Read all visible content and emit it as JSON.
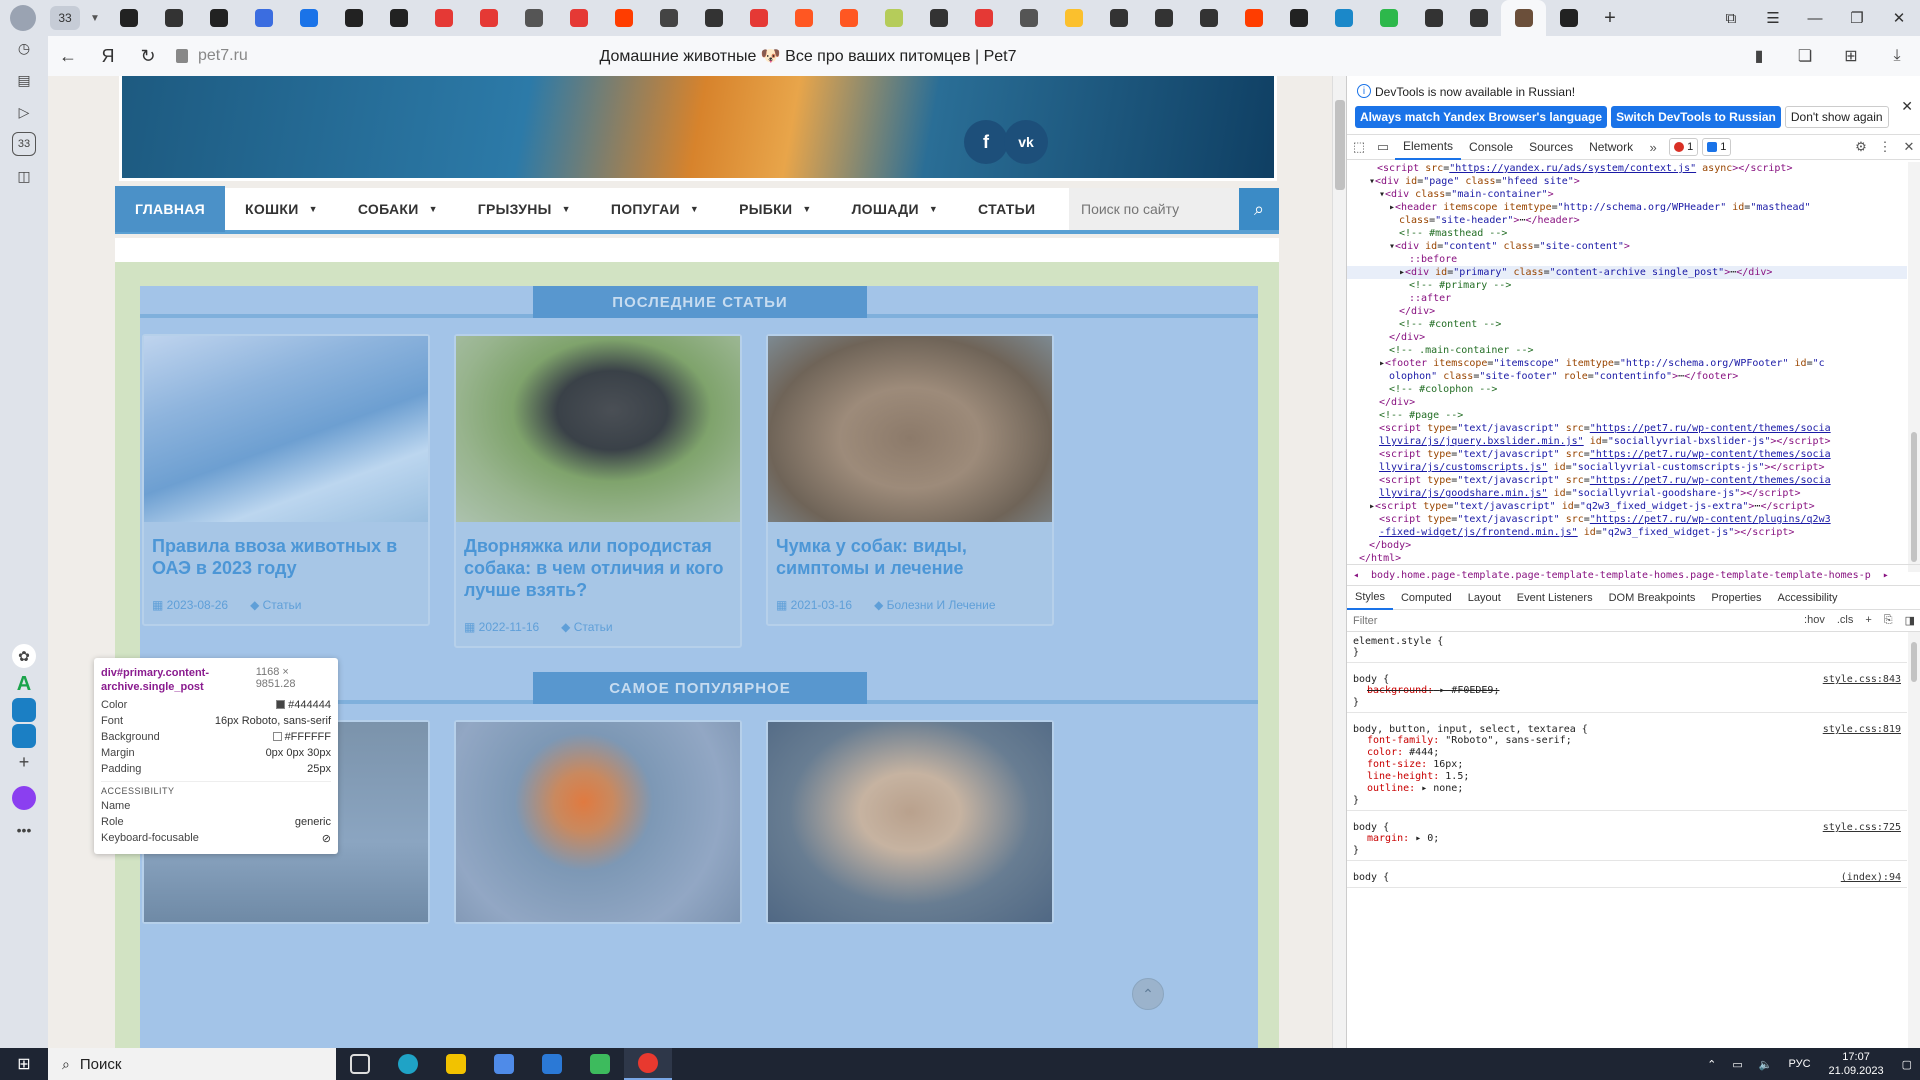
{
  "browser": {
    "tab_counter": "33",
    "url": "pet7.ru",
    "page_title": "Домашние животные 🐶 Все про ваших питомцев | Pet7",
    "tab_favicon_colors": [
      "#222222",
      "#333333",
      "#222222",
      "#3b6de0",
      "#1a73e8",
      "#222222",
      "#222222",
      "#e53935",
      "#e53935",
      "#555555",
      "#e53935",
      "#ff3d00",
      "#444444",
      "#333333",
      "#e53935",
      "#ff5722",
      "#ff5722",
      "#b5cc5a",
      "#333333",
      "#e53935",
      "#555555",
      "#fbc02d",
      "#333333",
      "#333333",
      "#333333",
      "#ff3d00",
      "#222222",
      "#1b88c9",
      "#2db84b",
      "#333333",
      "#333333",
      "#6b4f3a",
      "#222222"
    ]
  },
  "yandex_sidebar": {
    "icons": [
      "history-icon",
      "collections-icon",
      "video-icon",
      "tabs-counter-icon",
      "screenshot-icon",
      "chatgpt-icon",
      "green-a-icon",
      "service-icon-1",
      "service-icon-2",
      "add-icon",
      "alice-icon",
      "more-icon"
    ],
    "tabs_counter_label": "33"
  },
  "site": {
    "nav": {
      "items": [
        {
          "label": "ГЛАВНАЯ",
          "has_caret": false
        },
        {
          "label": "КОШКИ",
          "has_caret": true
        },
        {
          "label": "СОБАКИ",
          "has_caret": true
        },
        {
          "label": "ГРЫЗУНЫ",
          "has_caret": true
        },
        {
          "label": "ПОПУГАИ",
          "has_caret": true
        },
        {
          "label": "РЫБКИ",
          "has_caret": true
        },
        {
          "label": "ЛОШАДИ",
          "has_caret": true
        },
        {
          "label": "СТАТЬИ",
          "has_caret": false
        }
      ],
      "search_placeholder": "Поиск по сайту"
    },
    "social": {
      "facebook": "f",
      "vk": "vk"
    },
    "sections": [
      {
        "title": "ПОСЛЕДНИЕ СТАТЬИ",
        "cards": [
          {
            "title": "Правила ввоза животных в ОАЭ в 2023 году",
            "date": "2023-08-26",
            "category": "Статьи",
            "image": "city-harbor"
          },
          {
            "title": "Дворняжка или породистая собака: в чем отличия и кого лучше взять?",
            "date": "2022-11-16",
            "category": "Статьи",
            "image": "dog-handshake"
          },
          {
            "title": "Чумка у собак: виды, симптомы и лечение",
            "date": "2021-03-16",
            "category": "Болезни И Лечение",
            "image": "beagle"
          }
        ]
      },
      {
        "title": "САМОЕ ПОПУЛЯРНОЕ",
        "cards": [
          {
            "image": "bird"
          },
          {
            "image": "clownfish"
          },
          {
            "image": "cat-at-table"
          }
        ]
      }
    ]
  },
  "inspect_tooltip": {
    "selector": "div#primary.content-archive.single_post",
    "size": "1168 × 9851.28",
    "rows": [
      {
        "k": "Color",
        "v": "#444444",
        "swatch": "#444444"
      },
      {
        "k": "Font",
        "v": "16px Roboto, sans-serif"
      },
      {
        "k": "Background",
        "v": "#FFFFFF",
        "swatch": "#FFFFFF"
      },
      {
        "k": "Margin",
        "v": "0px 0px 30px"
      },
      {
        "k": "Padding",
        "v": "25px"
      }
    ],
    "accessibility_title": "ACCESSIBILITY",
    "a11y_rows": [
      {
        "k": "Name",
        "v": ""
      },
      {
        "k": "Role",
        "v": "generic"
      },
      {
        "k": "Keyboard-focusable",
        "v": "⊘"
      }
    ]
  },
  "devtools": {
    "info_message": "DevTools is now available in Russian!",
    "btn_match": "Always match Yandex Browser's language",
    "btn_switch": "Switch DevTools to Russian",
    "btn_dont_show": "Don't show again",
    "tabs": [
      "Elements",
      "Console",
      "Sources",
      "Network"
    ],
    "error_count": "1",
    "message_count": "1",
    "breadcrumb": "body.home.page-template.page-template-template-homes.page-template-template-homes-p",
    "styles_tabs": [
      "Styles",
      "Computed",
      "Layout",
      "Event Listeners",
      "DOM Breakpoints",
      "Properties",
      "Accessibility"
    ],
    "filter_placeholder": "Filter",
    "filter_hov": ":hov",
    "filter_cls": ".cls",
    "rules": [
      {
        "selector": "element.style {",
        "source": "",
        "decls": [],
        "close": "}"
      },
      {
        "selector": "body {",
        "source": "style.css:843",
        "decls": [
          {
            "p": "background:",
            "v": "▸ #F0EDE9;",
            "strike": true
          }
        ],
        "close": "}"
      },
      {
        "selector": "body, button, input, select, textarea {",
        "source": "style.css:819",
        "decls": [
          {
            "p": "font-family:",
            "v": "\"Roboto\", sans-serif;"
          },
          {
            "p": "color:",
            "v": "#444;"
          },
          {
            "p": "font-size:",
            "v": "16px;"
          },
          {
            "p": "line-height:",
            "v": "1.5;"
          },
          {
            "p": "outline:",
            "v": "▸ none;"
          }
        ],
        "close": "}"
      },
      {
        "selector": "body {",
        "source": "style.css:725",
        "decls": [
          {
            "p": "margin:",
            "v": "▸ 0;"
          }
        ],
        "close": "}"
      },
      {
        "selector": "body {",
        "source": "(index):94",
        "decls": [],
        "close": ""
      }
    ]
  },
  "taskbar": {
    "search_label": "Поиск",
    "lang": "РУС",
    "time": "17:07",
    "date": "21.09.2023"
  }
}
